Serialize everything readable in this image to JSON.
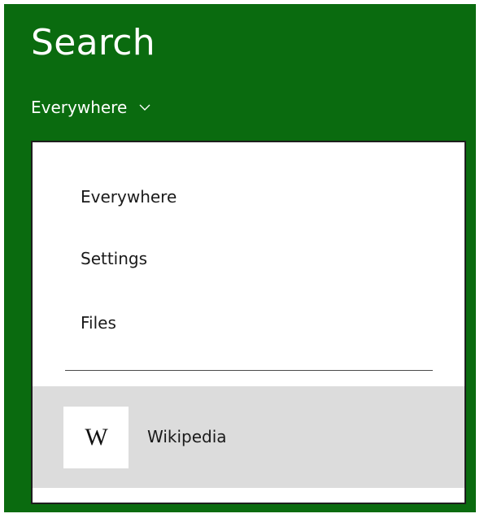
{
  "pane": {
    "title": "Search",
    "background_color": "#0a6b0f"
  },
  "scope": {
    "selected": "Everywhere",
    "icon": "chevron-down-icon"
  },
  "menu": {
    "items": [
      {
        "label": "Everywhere"
      },
      {
        "label": "Settings"
      },
      {
        "label": "Files"
      }
    ],
    "apps": [
      {
        "label": "Wikipedia",
        "icon": "wikipedia-icon",
        "icon_glyph": "W",
        "highlighted": true
      }
    ],
    "highlight_color": "#dcdcdc"
  }
}
